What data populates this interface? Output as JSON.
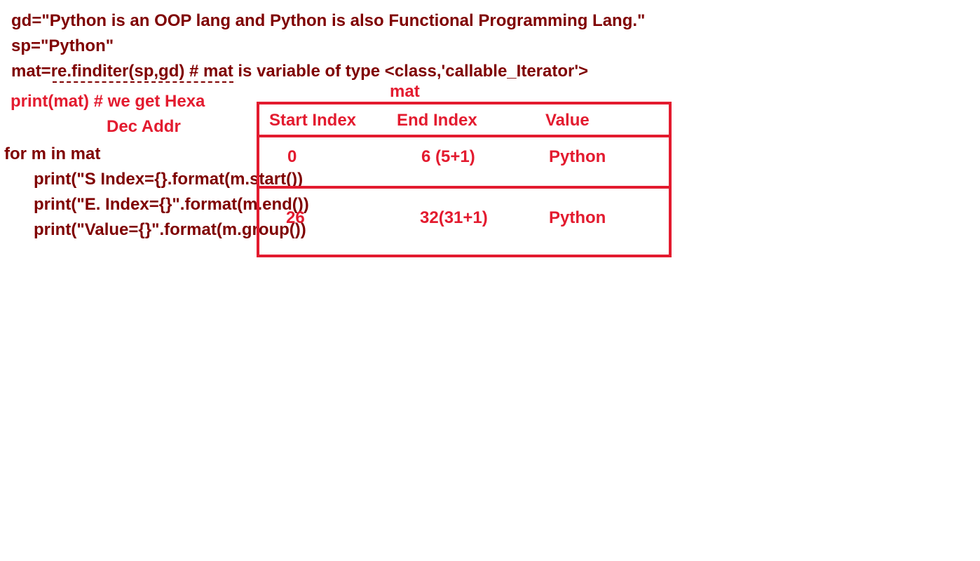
{
  "code": {
    "line1": "gd=\"Python is an OOP lang and Python is also Functional Programming Lang.\"",
    "line2": "sp=\"Python\"",
    "line3": "mat=re.finditer(sp,gd) # mat is variable of type <class,'callable_Iterator'>",
    "line4": "print(mat) # we get Hexa",
    "line4b": "Dec Addr",
    "line5": "for m in mat",
    "line6": "print(\"S Index={}.format(m.start())",
    "line7": "print(\"E. Index={}\".format(m.end())",
    "line8": "print(\"Value={}\".format(m.group())"
  },
  "table": {
    "title": "mat",
    "headers": [
      "Start Index",
      "End Index",
      "Value"
    ],
    "rows": [
      [
        "0",
        "6 (5+1)",
        "Python"
      ],
      [
        "26",
        "32(31+1)",
        "Python"
      ]
    ]
  },
  "colors": {
    "code_dark_red": "#7f0000",
    "annotation_red": "#e31b2f"
  }
}
